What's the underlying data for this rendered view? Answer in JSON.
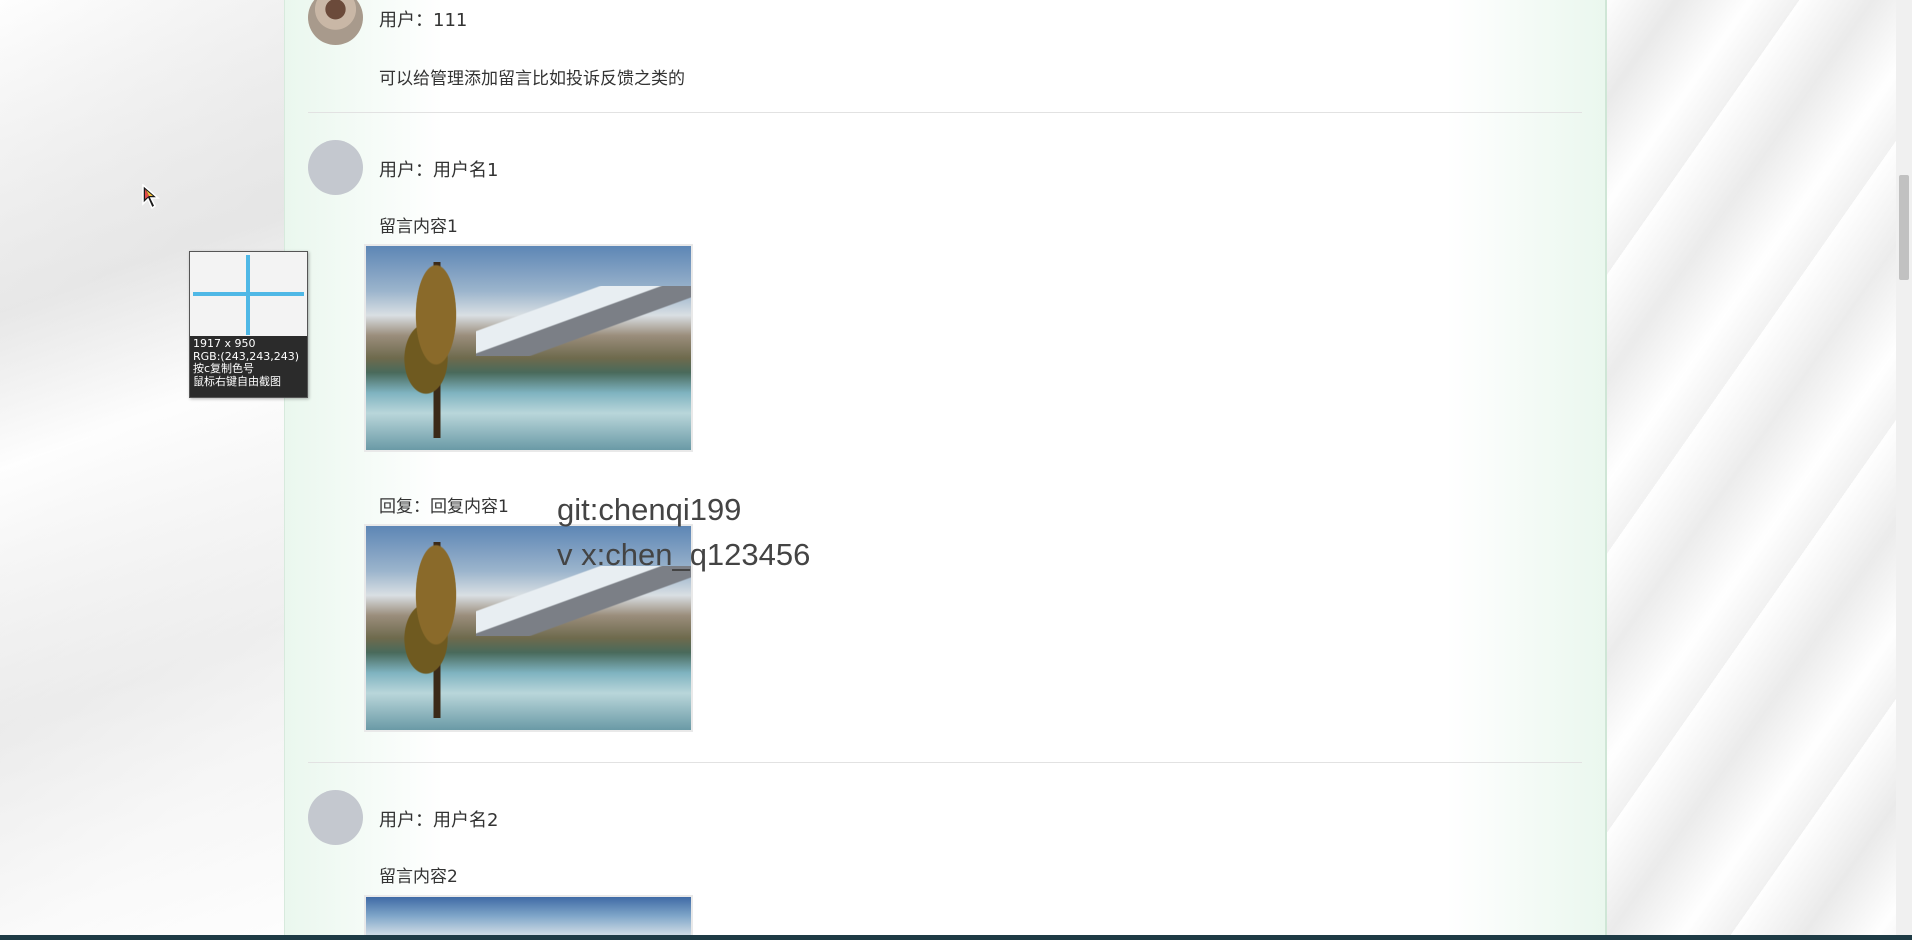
{
  "messages": [
    {
      "user_label": "用户：111",
      "content": "可以给管理添加留言比如投诉反馈之类的",
      "avatar": "user-photo"
    },
    {
      "user_label": "用户：用户名1",
      "content": "留言内容1",
      "image": "landscape-lake-mountain",
      "reply_label": "回复：回复内容1",
      "reply_image": "landscape-lake-mountain"
    },
    {
      "user_label": "用户：用户名2",
      "content": "留言内容2",
      "image": "landscape-mountain-partial"
    }
  ],
  "watermark": {
    "line1": "git:chenqi199",
    "line2": "v x:chen_q123456"
  },
  "color_picker_tool": {
    "size": "1917 x 950",
    "rgb": "RGB:(243,243,243)",
    "hint_copy": "按c复制色号",
    "hint_capture": "鼠标右键自由截图"
  },
  "colors": {
    "accent_crosshair": "#4fb8e6",
    "panel_edge": "#eaf7ee",
    "taskbar": "#1e3b45"
  }
}
